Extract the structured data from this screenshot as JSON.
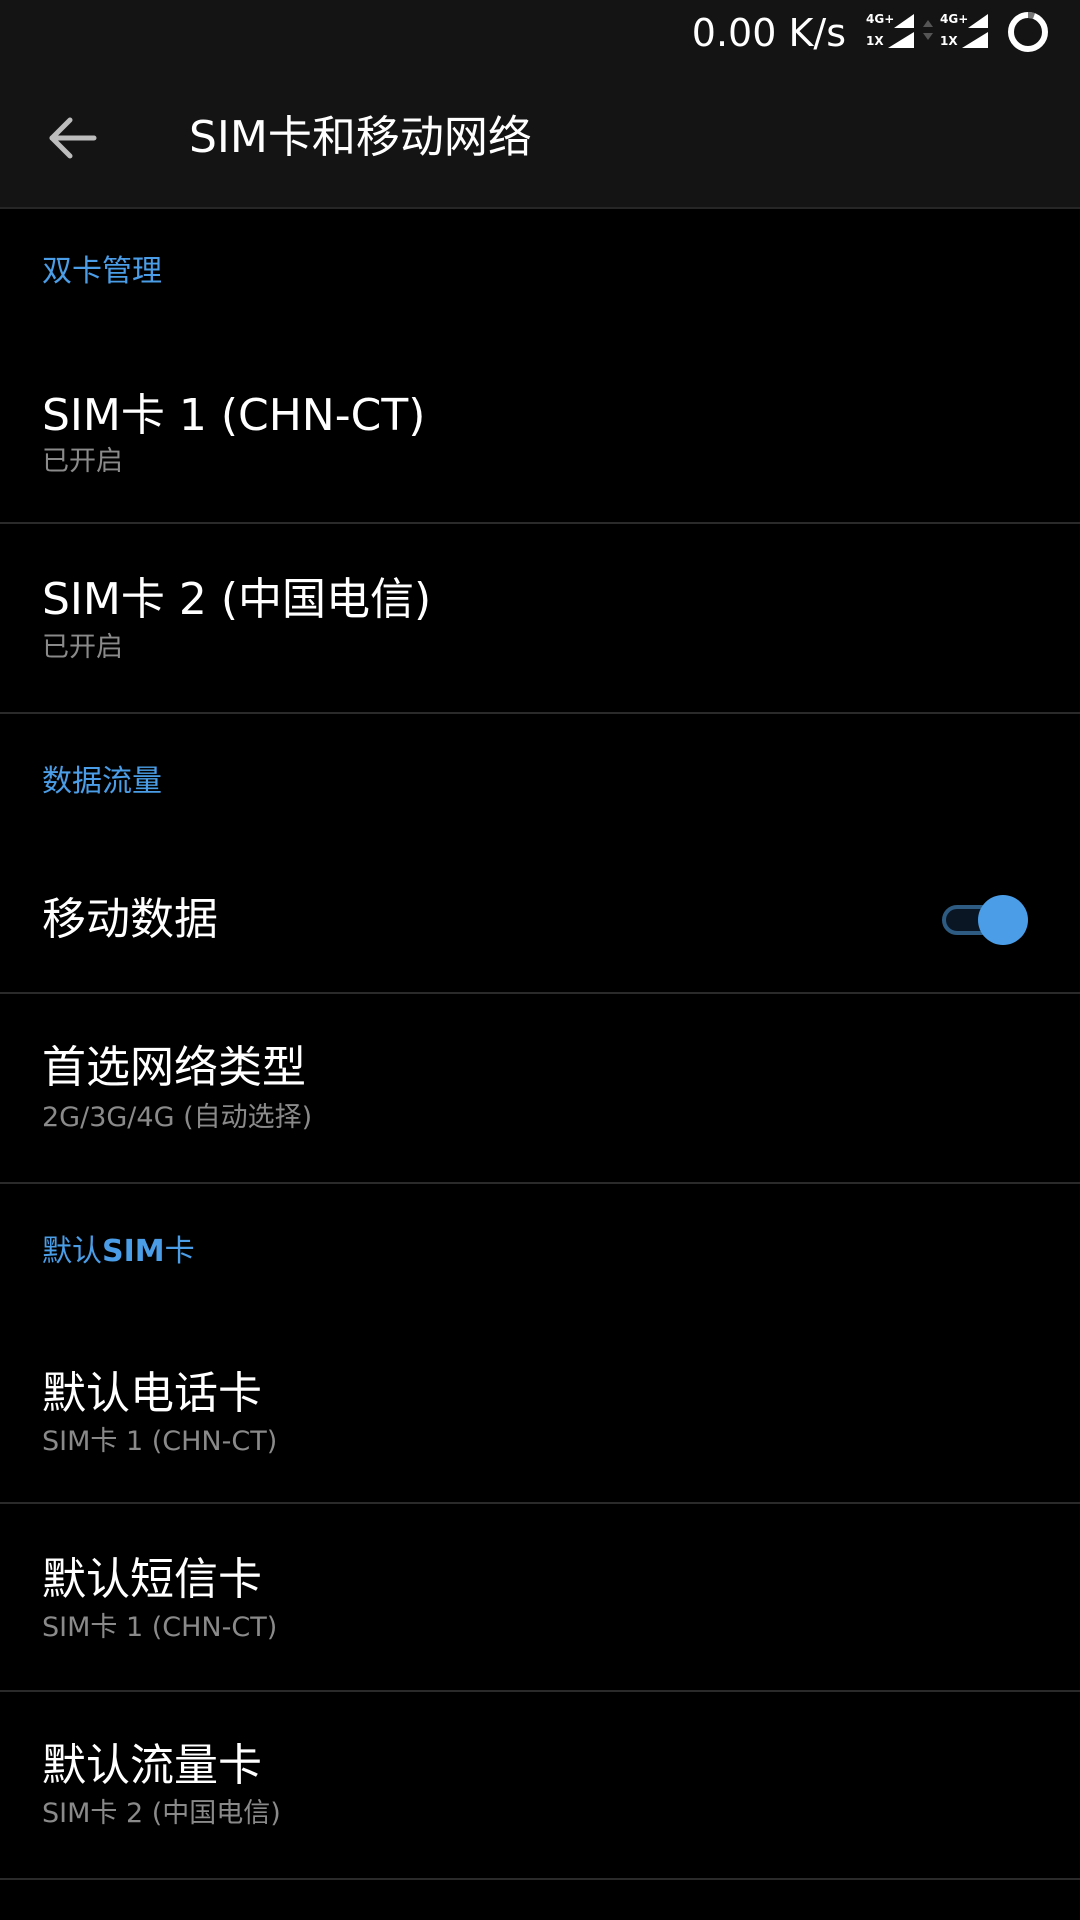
{
  "status_bar": {
    "net_speed": "0.00 K/s",
    "sim1_network": "4G+",
    "sim1_sub": "1X",
    "sim2_network": "4G+",
    "sim2_sub": "1X",
    "battery_icon": "battery-ring-icon"
  },
  "toolbar": {
    "back_icon": "arrow-back-icon",
    "title": "SIM卡和移动网络"
  },
  "sections": {
    "dual_sim": {
      "header": "双卡管理",
      "sim1": {
        "title": "SIM卡 1 (CHN-CT)",
        "status": "已开启"
      },
      "sim2": {
        "title": "SIM卡 2 (中国电信)",
        "status": "已开启"
      }
    },
    "data": {
      "header": "数据流量",
      "mobile_data": {
        "title": "移动数据",
        "enabled": true
      },
      "network_type": {
        "title": "首选网络类型",
        "value": "2G/3G/4G (自动选择)"
      }
    },
    "default_sim": {
      "header_prefix": "默认",
      "header_bold": "SIM",
      "header_suffix": "卡",
      "call": {
        "title": "默认电话卡",
        "value": "SIM卡 1 (CHN-CT)"
      },
      "sms": {
        "title": "默认短信卡",
        "value": "SIM卡 1 (CHN-CT)"
      },
      "data": {
        "title": "默认流量卡",
        "value": "SIM卡 2 (中国电信)"
      }
    }
  },
  "colors": {
    "accent": "#4a9de6",
    "background": "#000000",
    "toolbar": "#141414",
    "divider": "#2a2a2a",
    "secondary_text": "#8a8a8a"
  }
}
